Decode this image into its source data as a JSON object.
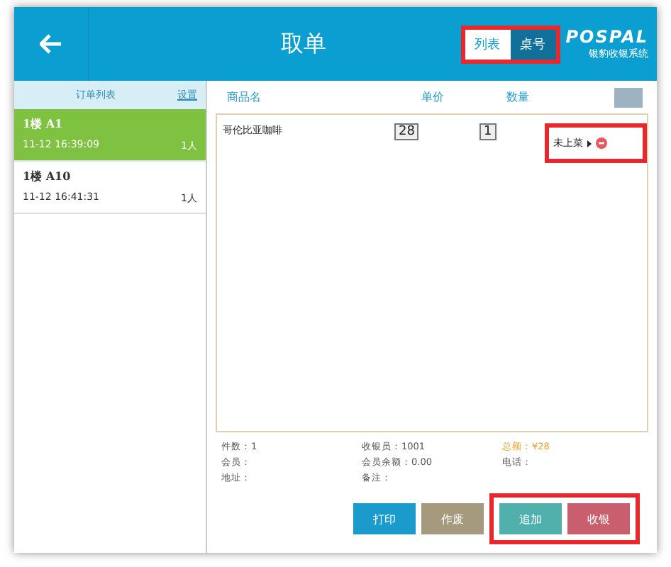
{
  "header": {
    "title": "取单",
    "view_toggle": [
      {
        "label": "列表",
        "selected": true
      },
      {
        "label": "桌号",
        "selected": false
      }
    ],
    "logo": {
      "name": "POSPAL",
      "subtitle": "银豹收银系统"
    }
  },
  "sidebar": {
    "title": "订单列表",
    "settings_link": "设置",
    "orders": [
      {
        "table": "1楼 A1",
        "time": "11-12 16:39:09",
        "people": "1人",
        "selected": true
      },
      {
        "table": "1楼 A10",
        "time": "11-12 16:41:31",
        "people": "1人",
        "selected": false
      }
    ]
  },
  "table": {
    "columns": [
      "商品名",
      "单价",
      "数量"
    ],
    "rows": [
      {
        "name": "哥伦比亚咖啡",
        "price": "28",
        "quantity": "1",
        "status": "未上菜",
        "highlighted": true
      }
    ]
  },
  "summary": [
    {
      "label": "件数：1",
      "kind": "plain"
    },
    {
      "label": "收银员：1001",
      "kind": "plain"
    },
    {
      "label": "总额：¥28",
      "kind": "total"
    },
    {
      "label": "会员：",
      "kind": "plain"
    },
    {
      "label": "会员余额：0.00",
      "kind": "plain"
    },
    {
      "label": "电话：",
      "kind": "plain"
    },
    {
      "label": "地址：",
      "kind": "plain"
    },
    {
      "label": "备注：",
      "kind": "plain"
    }
  ],
  "buttons": [
    {
      "label": "打印",
      "color": "#1a9bcc",
      "highlighted": false
    },
    {
      "label": "作废",
      "color": "#a59a7e",
      "highlighted": false
    },
    {
      "label": "追加",
      "color": "#4fb0ac",
      "highlighted": true
    },
    {
      "label": "收银",
      "color": "#c95f6e",
      "highlighted": true
    }
  ]
}
